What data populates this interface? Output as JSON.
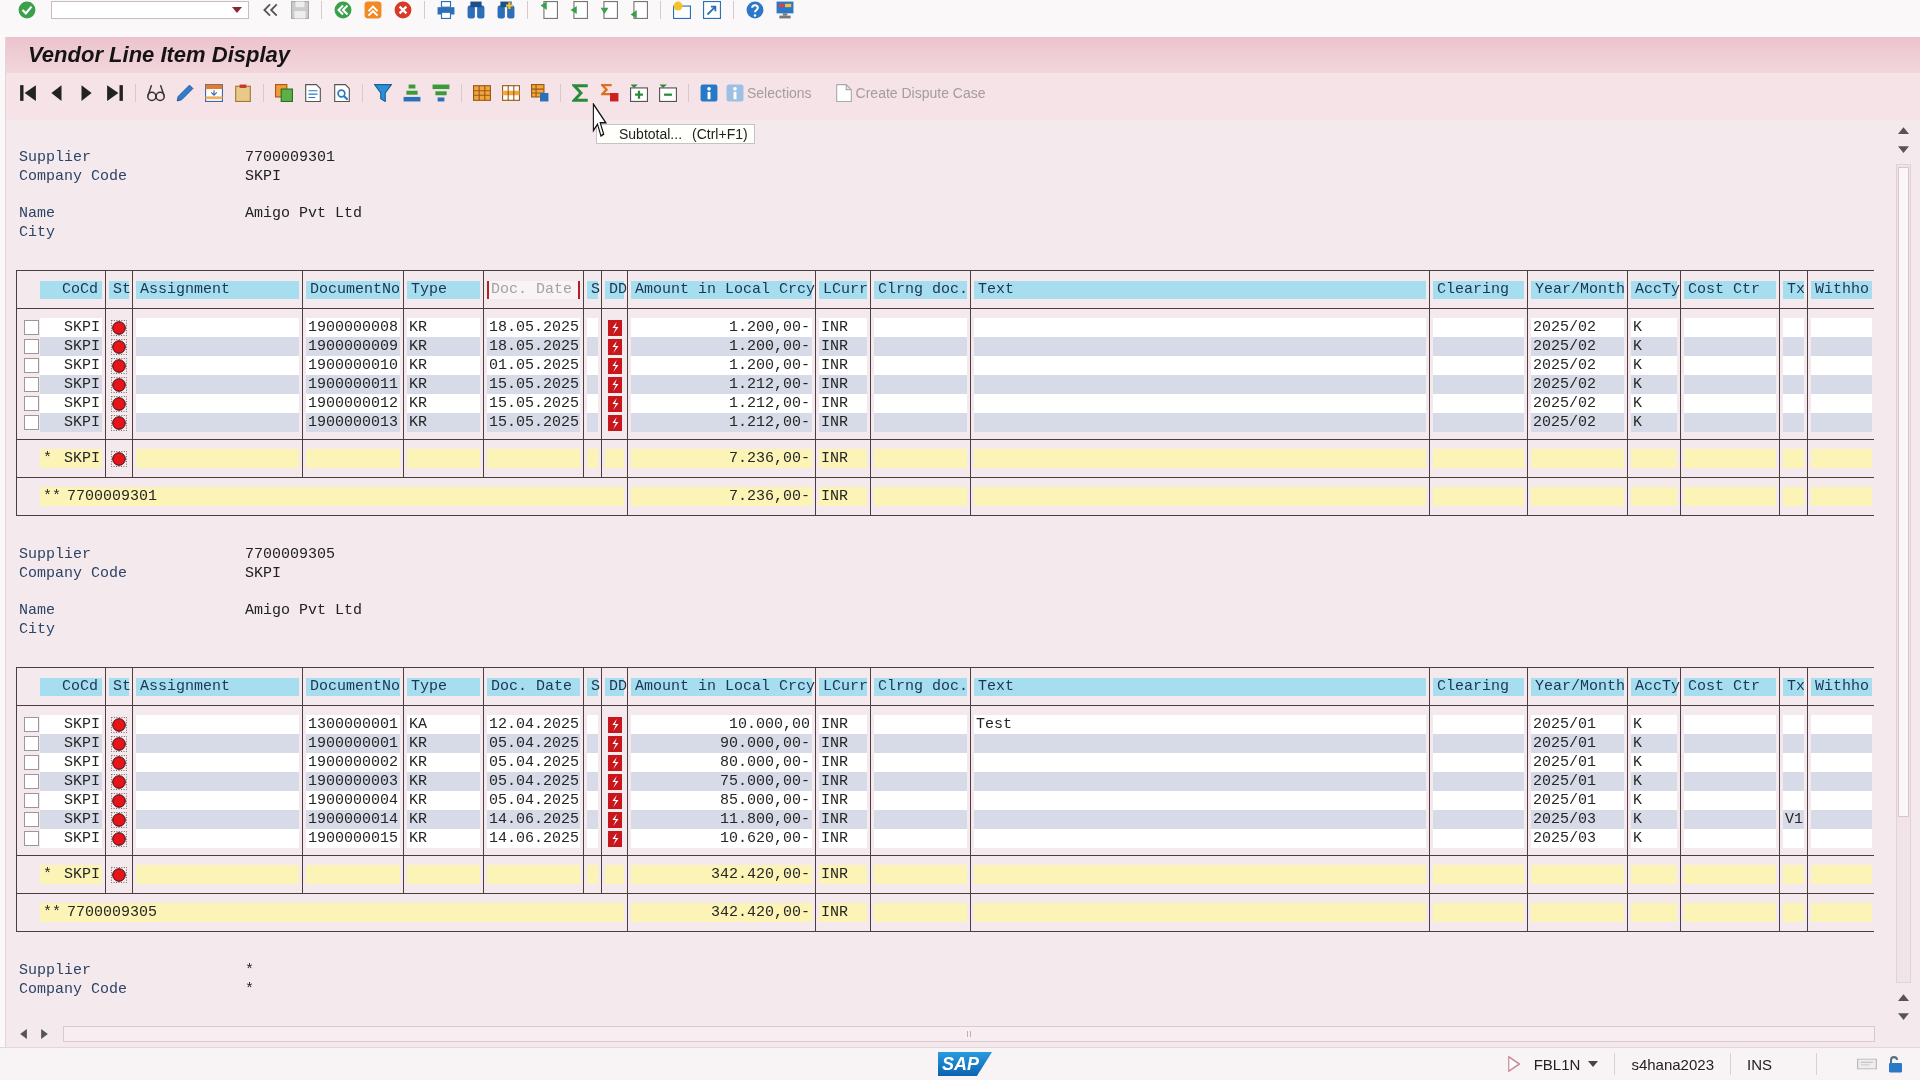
{
  "window": {
    "title": "Vendor Line Item Display"
  },
  "toolbar": {
    "buttons": [
      {
        "label": "Selections",
        "disabled": true
      },
      {
        "label": "Create Dispute Case",
        "disabled": true
      }
    ]
  },
  "tooltip": {
    "label": "Subtotal...",
    "shortcut": "(Ctrl+F1)"
  },
  "groups": [
    {
      "field_blocks": [
        [
          {
            "label": "Supplier",
            "value": "7700009301"
          },
          {
            "label": "Company Code",
            "value": "SKPI"
          }
        ],
        [
          {
            "label": "Name",
            "value": "Amigo Pvt Ltd"
          },
          {
            "label": "City"
          }
        ]
      ],
      "table": {
        "columns": [
          {
            "label": "CoCd",
            "selected": false
          },
          {
            "label": "St",
            "selected": false
          },
          {
            "label": "Assignment",
            "selected": false
          },
          {
            "label": "DocumentNo",
            "selected": false
          },
          {
            "label": "Type",
            "selected": false
          },
          {
            "label": "Doc. Date",
            "selected": true
          },
          {
            "label": "S",
            "selected": false
          },
          {
            "label": "DD",
            "selected": false
          },
          {
            "label": "Amount in Local Crcy",
            "selected": false
          },
          {
            "label": "LCurr",
            "selected": false
          },
          {
            "label": "Clrng doc.",
            "selected": false
          },
          {
            "label": "Text",
            "selected": false
          },
          {
            "label": "Clearing",
            "selected": false
          },
          {
            "label": "Year/Month",
            "selected": false
          },
          {
            "label": "AccTy",
            "selected": false
          },
          {
            "label": "Cost Ctr",
            "selected": false
          },
          {
            "label": "Tx",
            "selected": false
          },
          {
            "label": "Withho",
            "selected": false
          }
        ],
        "rows": [
          {
            "checked": false,
            "company_code": "SKPI",
            "document_no": "1900000008",
            "document_type": "KR",
            "document_date": "18.05.2025",
            "amount": "1.200,00-",
            "currency": "INR",
            "year_month": "2025/02",
            "account_type": "K"
          },
          {
            "checked": false,
            "company_code": "SKPI",
            "document_no": "1900000009",
            "document_type": "KR",
            "document_date": "18.05.2025",
            "amount": "1.200,00-",
            "currency": "INR",
            "year_month": "2025/02",
            "account_type": "K"
          },
          {
            "checked": false,
            "company_code": "SKPI",
            "document_no": "1900000010",
            "document_type": "KR",
            "document_date": "01.05.2025",
            "amount": "1.200,00-",
            "currency": "INR",
            "year_month": "2025/02",
            "account_type": "K"
          },
          {
            "checked": false,
            "company_code": "SKPI",
            "document_no": "1900000011",
            "document_type": "KR",
            "document_date": "15.05.2025",
            "amount": "1.212,00-",
            "currency": "INR",
            "year_month": "2025/02",
            "account_type": "K"
          },
          {
            "checked": false,
            "company_code": "SKPI",
            "document_no": "1900000012",
            "document_type": "KR",
            "document_date": "15.05.2025",
            "amount": "1.212,00-",
            "currency": "INR",
            "year_month": "2025/02",
            "account_type": "K"
          },
          {
            "checked": false,
            "company_code": "SKPI",
            "document_no": "1900000013",
            "document_type": "KR",
            "document_date": "15.05.2025",
            "amount": "1.212,00-",
            "currency": "INR",
            "year_month": "2025/02",
            "account_type": "K"
          }
        ],
        "subtotal": {
          "marker": "*",
          "company_code": "SKPI",
          "amount": "7.236,00-",
          "currency": "INR"
        },
        "total": {
          "marker": "**",
          "supplier": "7700009301",
          "amount": "7.236,00-",
          "currency": "INR"
        }
      }
    },
    {
      "field_blocks": [
        [
          {
            "label": "Supplier",
            "value": "7700009305"
          },
          {
            "label": "Company Code",
            "value": "SKPI"
          }
        ],
        [
          {
            "label": "Name",
            "value": "Amigo Pvt Ltd"
          },
          {
            "label": "City"
          }
        ]
      ],
      "table": {
        "columns": [
          {
            "label": "CoCd",
            "selected": false
          },
          {
            "label": "St",
            "selected": false
          },
          {
            "label": "Assignment",
            "selected": false
          },
          {
            "label": "DocumentNo",
            "selected": false
          },
          {
            "label": "Type",
            "selected": false
          },
          {
            "label": "Doc. Date",
            "selected": false
          },
          {
            "label": "S",
            "selected": false
          },
          {
            "label": "DD",
            "selected": false
          },
          {
            "label": "Amount in Local Crcy",
            "selected": false
          },
          {
            "label": "LCurr",
            "selected": false
          },
          {
            "label": "Clrng doc.",
            "selected": false
          },
          {
            "label": "Text",
            "selected": false
          },
          {
            "label": "Clearing",
            "selected": false
          },
          {
            "label": "Year/Month",
            "selected": false
          },
          {
            "label": "AccTy",
            "selected": false
          },
          {
            "label": "Cost Ctr",
            "selected": false
          },
          {
            "label": "Tx",
            "selected": false
          },
          {
            "label": "Withho",
            "selected": false
          }
        ],
        "rows": [
          {
            "checked": false,
            "company_code": "SKPI",
            "document_no": "1300000001",
            "document_type": "KA",
            "document_date": "12.04.2025",
            "amount": "10.000,00",
            "currency": "INR",
            "text": "Test",
            "year_month": "2025/01",
            "account_type": "K"
          },
          {
            "checked": false,
            "company_code": "SKPI",
            "document_no": "1900000001",
            "document_type": "KR",
            "document_date": "05.04.2025",
            "amount": "90.000,00-",
            "currency": "INR",
            "year_month": "2025/01",
            "account_type": "K"
          },
          {
            "checked": false,
            "company_code": "SKPI",
            "document_no": "1900000002",
            "document_type": "KR",
            "document_date": "05.04.2025",
            "amount": "80.000,00-",
            "currency": "INR",
            "year_month": "2025/01",
            "account_type": "K"
          },
          {
            "checked": false,
            "company_code": "SKPI",
            "document_no": "1900000003",
            "document_type": "KR",
            "document_date": "05.04.2025",
            "amount": "75.000,00-",
            "currency": "INR",
            "year_month": "2025/01",
            "account_type": "K"
          },
          {
            "checked": false,
            "company_code": "SKPI",
            "document_no": "1900000004",
            "document_type": "KR",
            "document_date": "05.04.2025",
            "amount": "85.000,00-",
            "currency": "INR",
            "year_month": "2025/01",
            "account_type": "K"
          },
          {
            "checked": false,
            "company_code": "SKPI",
            "document_no": "1900000014",
            "document_type": "KR",
            "document_date": "14.06.2025",
            "amount": "11.800,00-",
            "currency": "INR",
            "year_month": "2025/03",
            "account_type": "K",
            "tax_code": "V1"
          },
          {
            "checked": false,
            "company_code": "SKPI",
            "document_no": "1900000015",
            "document_type": "KR",
            "document_date": "14.06.2025",
            "amount": "10.620,00-",
            "currency": "INR",
            "year_month": "2025/03",
            "account_type": "K"
          }
        ],
        "subtotal": {
          "marker": "*",
          "company_code": "SKPI",
          "amount": "342.420,00-",
          "currency": "INR"
        },
        "total": {
          "marker": "**",
          "supplier": "7700009305",
          "amount": "342.420,00-",
          "currency": "INR"
        }
      }
    }
  ],
  "footer_fields": [
    {
      "label": "Supplier",
      "value": "*"
    },
    {
      "label": "Company Code",
      "value": "*"
    }
  ],
  "status_bar": {
    "logo": "SAP",
    "transaction": "FBL1N",
    "system": "s4hana2023",
    "mode": "INS"
  }
}
